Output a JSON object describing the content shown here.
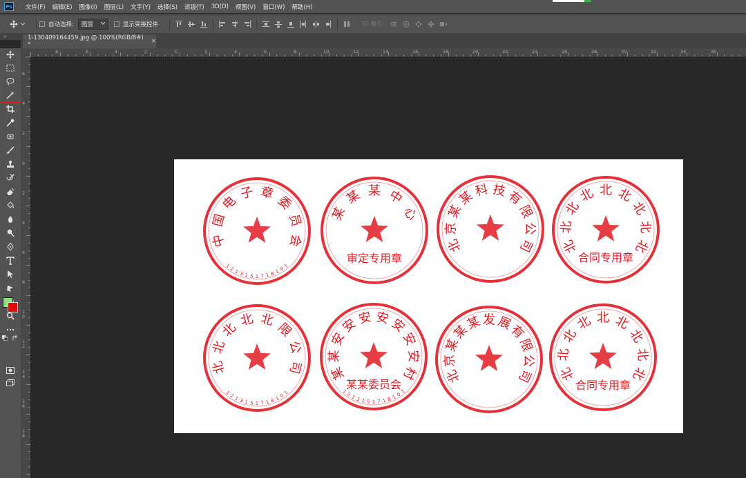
{
  "app": {
    "logo": "Ps",
    "accent": "#31a8ff"
  },
  "menu": [
    "文件(F)",
    "编辑(E)",
    "图像(I)",
    "图层(L)",
    "文字(Y)",
    "选择(S)",
    "滤镜(T)",
    "3D(D)",
    "视图(V)",
    "窗口(W)",
    "帮助(H)"
  ],
  "options": {
    "auto_select_label": "自动选择:",
    "auto_select_value": "图层",
    "show_transform_label": "显示变换控件",
    "mode_3d_label": "3D 模式:"
  },
  "document": {
    "tab_title": "1-130409164459.jpg @ 100%(RGB/8#) *",
    "close": "×"
  },
  "rulers": {
    "top": [
      "8",
      "6",
      "4",
      "2",
      "0",
      "2",
      "4",
      "6",
      "8",
      "10",
      "12",
      "14",
      "16",
      "18",
      "20",
      "22",
      "24",
      "26",
      "28",
      "30",
      "32",
      "34",
      "36"
    ],
    "left": [
      "6",
      "4",
      "2",
      "0",
      "2",
      "4",
      "6",
      "8",
      "1\n0",
      "1\n2",
      "1\n4",
      "1\n6",
      "1\n8"
    ]
  },
  "colors": {
    "foreground": "#8ce07a",
    "background": "#e00b0b",
    "stamp_red": "#e31b23"
  },
  "stamps": [
    {
      "ring": "中国电子章委员会",
      "bottom": "",
      "serial": "1213151718101"
    },
    {
      "ring": "某某某中心",
      "bottom": "审定专用章",
      "serial": ""
    },
    {
      "ring": "北京某某科技有限公司",
      "bottom": "",
      "serial": ""
    },
    {
      "ring": "北北北北北北北北北",
      "bottom": "合同专用章",
      "serial": ""
    },
    {
      "ring": "北北北北北限公司",
      "bottom": "",
      "serial": "1213151718101"
    },
    {
      "ring": "某某安安安安安安安村",
      "bottom": "某某委员会",
      "serial": "1213151718101"
    },
    {
      "ring": "北京某某某发展有限公司",
      "bottom": "",
      "serial": ""
    },
    {
      "ring": "北北北北北北北北北",
      "bottom": "合同专用章",
      "serial": ""
    }
  ]
}
